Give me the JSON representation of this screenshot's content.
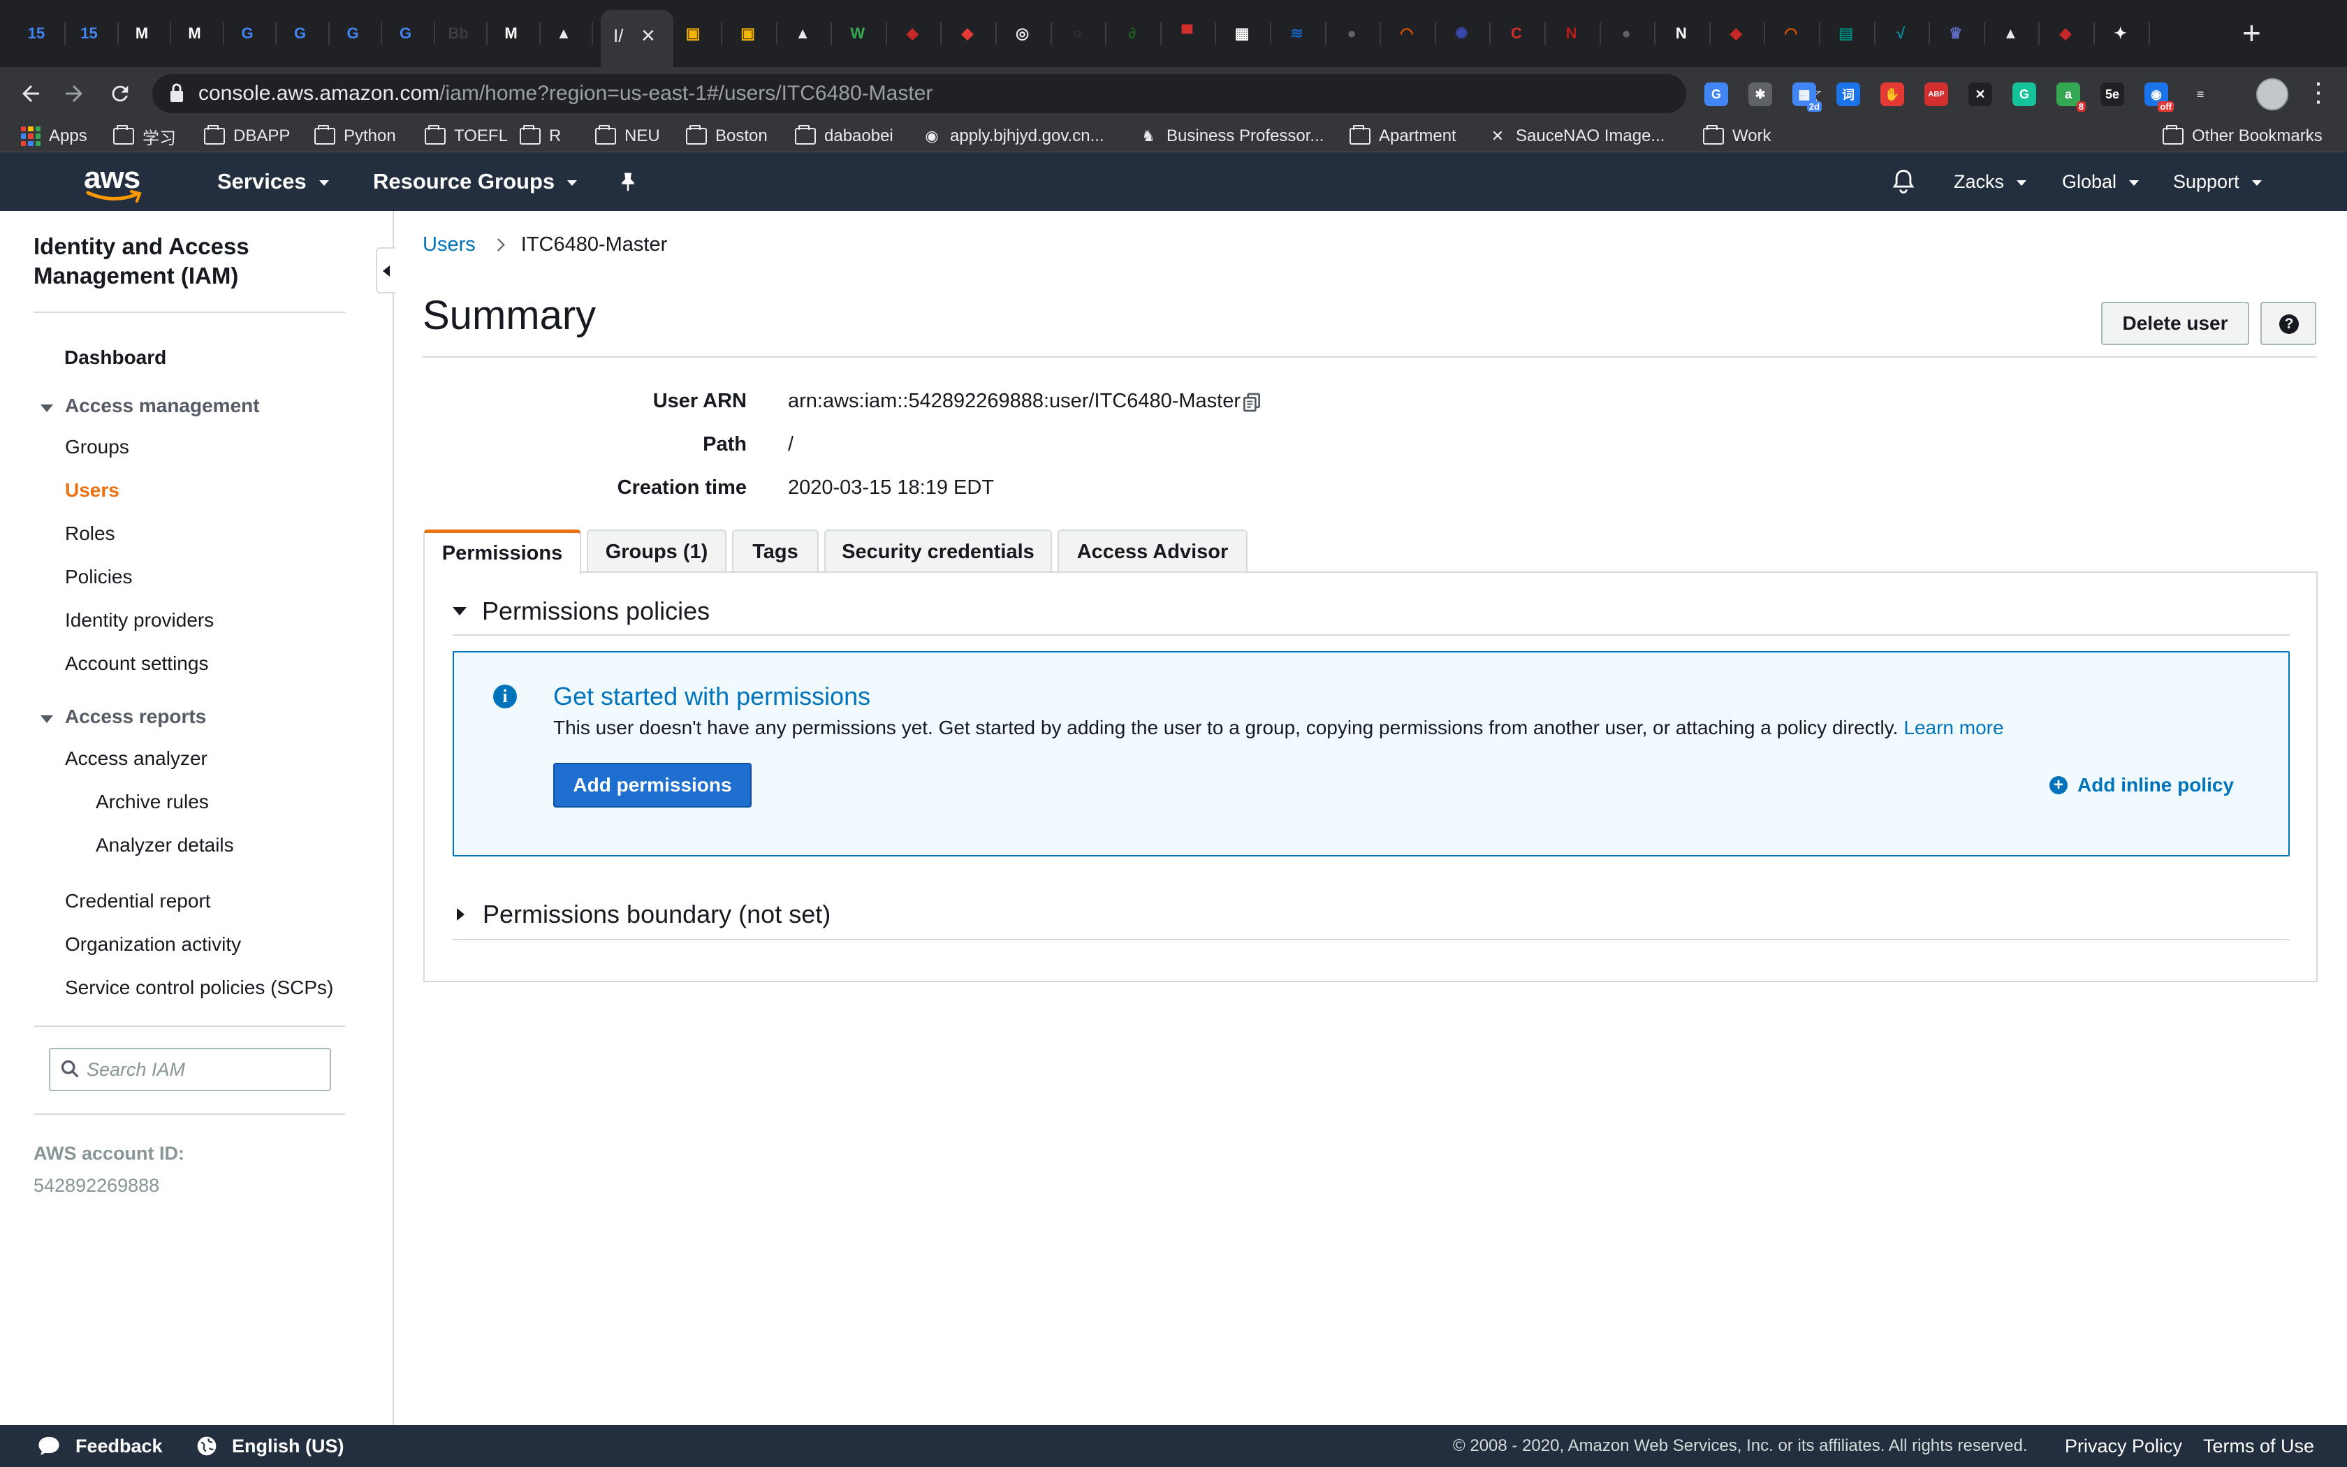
{
  "browser": {
    "tab_icons": [
      {
        "name": "calendar-icon",
        "color": "#4285f4",
        "glyph": "15"
      },
      {
        "name": "calendar-icon",
        "color": "#4285f4",
        "glyph": "15"
      },
      {
        "name": "gmail-icon",
        "color": "#ffffff",
        "glyph": "M"
      },
      {
        "name": "gmail-icon",
        "color": "#ffffff",
        "glyph": "M"
      },
      {
        "name": "translate-icon",
        "color": "#4285f4",
        "glyph": "G"
      },
      {
        "name": "translate-icon",
        "color": "#4285f4",
        "glyph": "G"
      },
      {
        "name": "translate-icon",
        "color": "#4285f4",
        "glyph": "G"
      },
      {
        "name": "translate-icon",
        "color": "#4285f4",
        "glyph": "G"
      },
      {
        "name": "site-icon",
        "color": "#3c3c3c",
        "glyph": "Bb"
      },
      {
        "name": "gmail-icon",
        "color": "#ffffff",
        "glyph": "M"
      },
      {
        "name": "graduation-cap-icon",
        "color": "#202124",
        "glyph": "▲"
      }
    ],
    "tab_icons_right": [
      {
        "name": "box-icon",
        "color": "#f4b400",
        "glyph": "▣"
      },
      {
        "name": "box-icon",
        "color": "#f4b400",
        "glyph": "▣"
      },
      {
        "name": "graduation-cap-icon",
        "color": "#202124",
        "glyph": "▲"
      },
      {
        "name": "wechat-icon",
        "color": "#34a853",
        "glyph": "W"
      },
      {
        "name": "site-icon",
        "color": "#c62828",
        "glyph": "◆"
      },
      {
        "name": "site-icon",
        "color": "#e53935",
        "glyph": "◆"
      },
      {
        "name": "site-icon",
        "color": "#202124",
        "glyph": "◎"
      },
      {
        "name": "site-icon",
        "color": "#3c3c3c",
        "glyph": "○"
      },
      {
        "name": "site-icon",
        "color": "#1b5e20",
        "glyph": "∂"
      },
      {
        "name": "site-icon",
        "color": "#d32f2f",
        "glyph": "▀"
      },
      {
        "name": "microsoft-icon",
        "color": "#ffffff",
        "glyph": "▦"
      },
      {
        "name": "site-icon",
        "color": "#1565c0",
        "glyph": "≋"
      },
      {
        "name": "github-icon",
        "color": "#5f6368",
        "glyph": "●"
      },
      {
        "name": "site-icon",
        "color": "#e65100",
        "glyph": "◠"
      },
      {
        "name": "site-icon",
        "color": "#3949ab",
        "glyph": "✺"
      },
      {
        "name": "site-icon",
        "color": "#d32f2f",
        "glyph": "C"
      },
      {
        "name": "site-icon",
        "color": "#b71c1c",
        "glyph": "N"
      },
      {
        "name": "github-icon",
        "color": "#5f6368",
        "glyph": "●"
      },
      {
        "name": "notion-icon",
        "color": "#ffffff",
        "glyph": "N"
      },
      {
        "name": "site-icon",
        "color": "#c62828",
        "glyph": "◆"
      },
      {
        "name": "site-icon",
        "color": "#e65100",
        "glyph": "◠"
      },
      {
        "name": "site-icon",
        "color": "#00897b",
        "glyph": "▤"
      },
      {
        "name": "site-icon",
        "color": "#0097a7",
        "glyph": "√"
      },
      {
        "name": "site-icon",
        "color": "#5c6bc0",
        "glyph": "♛"
      },
      {
        "name": "graduation-cap-icon",
        "color": "#202124",
        "glyph": "▲"
      },
      {
        "name": "site-icon",
        "color": "#c62828",
        "glyph": "◆"
      },
      {
        "name": "site-icon",
        "color": "#ffffff",
        "glyph": "✦"
      }
    ],
    "url_host": "console.aws.amazon.com",
    "url_path": "/iam/home?region=us-east-1#/users/ITC6480-Master",
    "extensions": [
      {
        "name": "translate-extension-icon",
        "color": "#4285f4",
        "glyph": "G",
        "badge": ""
      },
      {
        "name": "lightbulb-extension-icon",
        "color": "#5f6368",
        "glyph": "✱",
        "badge": ""
      },
      {
        "name": "calendar-extension-icon",
        "color": "#4285f4",
        "glyph": "▦",
        "badge": "2d"
      },
      {
        "name": "dictionary-extension-icon",
        "color": "#1a73e8",
        "glyph": "词",
        "badge": ""
      },
      {
        "name": "hand-extension-icon",
        "color": "#e53935",
        "glyph": "✋",
        "badge": ""
      },
      {
        "name": "adblock-extension-icon",
        "color": "#d32f2f",
        "glyph": "ABP",
        "badge": ""
      },
      {
        "name": "tools-extension-icon",
        "color": "#202124",
        "glyph": "✕",
        "badge": ""
      },
      {
        "name": "grammarly-extension-icon",
        "color": "#15c39a",
        "glyph": "G",
        "badge": ""
      },
      {
        "name": "extension-icon",
        "color": "#34a853",
        "glyph": "a",
        "badge": "8"
      },
      {
        "name": "extension-icon",
        "color": "#202124",
        "glyph": "5e",
        "badge": ""
      },
      {
        "name": "extension-icon",
        "color": "#1a73e8",
        "glyph": "◉",
        "badge": "off"
      },
      {
        "name": "reading-list-icon",
        "color": "#35363a",
        "glyph": "≡",
        "badge": ""
      }
    ],
    "bookmarks": [
      {
        "kind": "apps",
        "label": "Apps"
      },
      {
        "kind": "folder",
        "label": "学习"
      },
      {
        "kind": "folder",
        "label": "DBAPP"
      },
      {
        "kind": "folder",
        "label": "Python"
      },
      {
        "kind": "folder",
        "label": "TOEFL"
      },
      {
        "kind": "folder",
        "label": "R"
      },
      {
        "kind": "folder",
        "label": "NEU"
      },
      {
        "kind": "folder",
        "label": "Boston"
      },
      {
        "kind": "folder",
        "label": "dabaobei"
      },
      {
        "kind": "globe",
        "label": "apply.bjhjyd.gov.cn..."
      },
      {
        "kind": "site",
        "label": "Business Professor..."
      },
      {
        "kind": "folder",
        "label": "Apartment"
      },
      {
        "kind": "x",
        "label": "SauceNAO Image..."
      },
      {
        "kind": "folder",
        "label": "Work"
      }
    ],
    "other_bookmarks": "Other Bookmarks"
  },
  "aws_nav": {
    "logo_text": "aws",
    "services": "Services",
    "resource_groups": "Resource Groups",
    "user": "Zacks",
    "region": "Global",
    "support": "Support"
  },
  "sidebar": {
    "title": "Identity and Access Management (IAM)",
    "dashboard": "Dashboard",
    "access_management": "Access management",
    "groups": "Groups",
    "users": "Users",
    "roles": "Roles",
    "policies": "Policies",
    "identity_providers": "Identity providers",
    "account_settings": "Account settings",
    "access_reports": "Access reports",
    "access_analyzer": "Access analyzer",
    "archive_rules": "Archive rules",
    "analyzer_details": "Analyzer details",
    "credential_report": "Credential report",
    "organization_activity": "Organization activity",
    "scps": "Service control policies (SCPs)",
    "search_placeholder": "Search IAM",
    "account_id_label": "AWS account ID:",
    "account_id_value": "542892269888"
  },
  "main": {
    "breadcrumb_parent": "Users",
    "breadcrumb_current": "ITC6480-Master",
    "title": "Summary",
    "delete_button": "Delete user",
    "user_arn_label": "User ARN",
    "user_arn_value": "arn:aws:iam::542892269888:user/ITC6480-Master",
    "path_label": "Path",
    "path_value": "/",
    "creation_time_label": "Creation time",
    "creation_time_value": "2020-03-15 18:19 EDT",
    "tabs": [
      {
        "label": "Permissions"
      },
      {
        "label": "Groups (1)"
      },
      {
        "label": "Tags"
      },
      {
        "label": "Security credentials"
      },
      {
        "label": "Access Advisor"
      }
    ],
    "permissions_policies": "Permissions policies",
    "info_title": "Get started with permissions",
    "info_text": "This user doesn't have any permissions yet. Get started by adding the user to a group, copying permissions from another user, or attaching a policy directly.",
    "learn_more": "Learn more",
    "add_permissions": "Add permissions",
    "add_inline_policy": "Add inline policy",
    "permissions_boundary": "Permissions boundary (not set)"
  },
  "footer": {
    "feedback": "Feedback",
    "language": "English (US)",
    "copyright": "© 2008 - 2020, Amazon Web Services, Inc. or its affiliates. All rights reserved.",
    "privacy": "Privacy Policy",
    "terms": "Terms of Use"
  },
  "colors": {
    "aws_nav_bg": "#232f3e",
    "accent_orange": "#ec7211",
    "link_blue": "#0073bb",
    "primary_button": "#1f6fd0"
  }
}
